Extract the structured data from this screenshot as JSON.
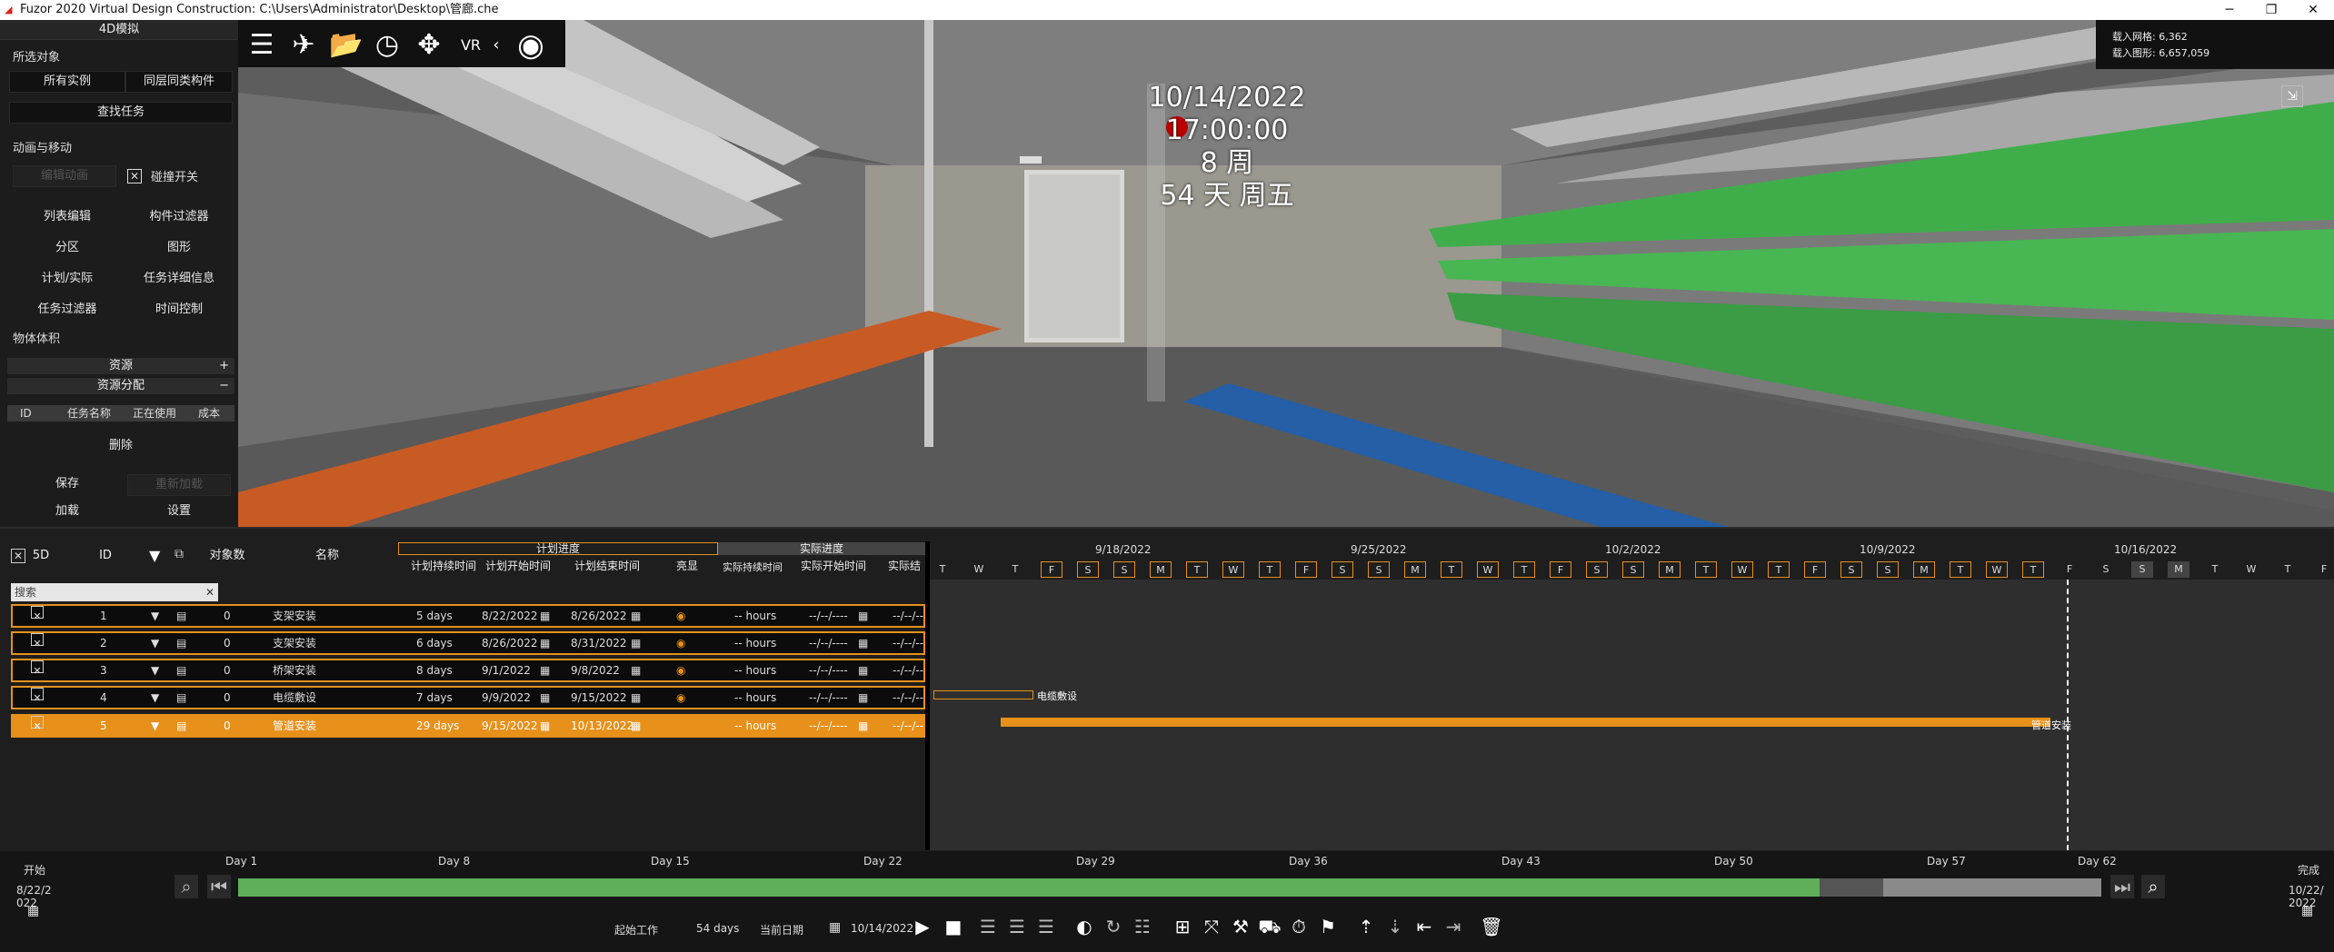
{
  "window": {
    "title": "Fuzor 2020 Virtual Design Construction: C:\\Users\\Administrator\\Desktop\\管廊.che",
    "min": "─",
    "max": "❐",
    "close": "✕"
  },
  "left_panel": {
    "title": "4D模拟",
    "selected_objects_label": "所选对象",
    "all_instances": "所有实例",
    "same_layer": "同层同类构件",
    "find_task": "查找任务",
    "anim_label": "动画与移动",
    "edit_anim": "编辑动画",
    "collision": "碰撞开关",
    "list_edit": "列表编辑",
    "component_filter": "构件过滤器",
    "zones": "分区",
    "graphics": "图形",
    "plan_actual": "计划/实际",
    "task_details": "任务详细信息",
    "task_filter": "任务过滤器",
    "time_control": "时间控制",
    "volume": "物体体积",
    "resources": "资源",
    "res_assign": "资源分配",
    "res_cols": [
      "ID",
      "任务名称",
      "正在使用",
      "成本"
    ],
    "delete": "删除",
    "save": "保存",
    "reload": "重新加载",
    "load": "加载",
    "settings": "设置"
  },
  "hud": {
    "datetime": "10/14/2022 17:00:00",
    "weeks": "8 周",
    "days": "54 天 周五"
  },
  "stats": {
    "grid": "载入网格: 6,362",
    "shapes": "载入图形: 6,657,059"
  },
  "gantt": {
    "label_5d": "5D",
    "col_id": "ID",
    "col_objcount": "对象数",
    "col_name": "名称",
    "plan_group": "计划进度",
    "actual_group": "实际进度",
    "plan_cols": [
      "计划持续时间",
      "计划开始时间",
      "计划结束时间"
    ],
    "highlight": "亮显",
    "actual_cols": [
      "实际持续时间",
      "实际开始时间",
      "实际结"
    ],
    "search_placeholder": "搜索",
    "tasks": [
      {
        "id": "1",
        "count": "0",
        "name": "支架安装",
        "dur": "5 days",
        "start": "8/22/2022",
        "end": "8/26/2022",
        "adur": "-- hours",
        "astart": "--/--/----",
        "aend": "--/--/--"
      },
      {
        "id": "2",
        "count": "0",
        "name": "支架安装",
        "dur": "6 days",
        "start": "8/26/2022",
        "end": "8/31/2022",
        "adur": "-- hours",
        "astart": "--/--/----",
        "aend": "--/--/--"
      },
      {
        "id": "3",
        "count": "0",
        "name": "桥架安装",
        "dur": "8 days",
        "start": "9/1/2022",
        "end": "9/8/2022",
        "adur": "-- hours",
        "astart": "--/--/----",
        "aend": "--/--/--"
      },
      {
        "id": "4",
        "count": "0",
        "name": "电缆敷设",
        "dur": "7 days",
        "start": "9/9/2022",
        "end": "9/15/2022",
        "adur": "-- hours",
        "astart": "--/--/----",
        "aend": "--/--/--"
      },
      {
        "id": "5",
        "count": "0",
        "name": "管道安装",
        "dur": "29 days",
        "start": "9/15/2022",
        "end": "10/13/2022",
        "adur": "-- hours",
        "astart": "--/--/----",
        "aend": "--/--/--"
      }
    ],
    "dates": [
      "9/18/2022",
      "9/25/2022",
      "10/2/2022",
      "10/9/2022",
      "10/16/2022"
    ],
    "weekdays": [
      "T",
      "W",
      "T",
      "F",
      "S",
      "S",
      "M",
      "T",
      "W",
      "T",
      "F",
      "S",
      "S",
      "M",
      "T",
      "W",
      "T",
      "F",
      "S",
      "S",
      "M",
      "T",
      "W",
      "T",
      "F",
      "S",
      "S",
      "M",
      "T",
      "W",
      "T",
      "F",
      "S",
      "S",
      "M",
      "T",
      "W",
      "T",
      "F"
    ],
    "bar_labels": [
      "电缆敷设",
      "管道安装"
    ]
  },
  "bottom": {
    "start_label": "开始",
    "start_date": "8/22/2022",
    "end_label": "完成",
    "end_date": "10/22/2022",
    "days": [
      "Day 1",
      "Day 8",
      "Day 15",
      "Day 22",
      "Day 29",
      "Day 36",
      "Day 43",
      "Day 50",
      "Day 57",
      "Day 62"
    ],
    "progress": 0.87,
    "work_start": "起始工作",
    "days_count": "54 days",
    "current_date_label": "当前日期",
    "current_date": "10/14/2022"
  }
}
